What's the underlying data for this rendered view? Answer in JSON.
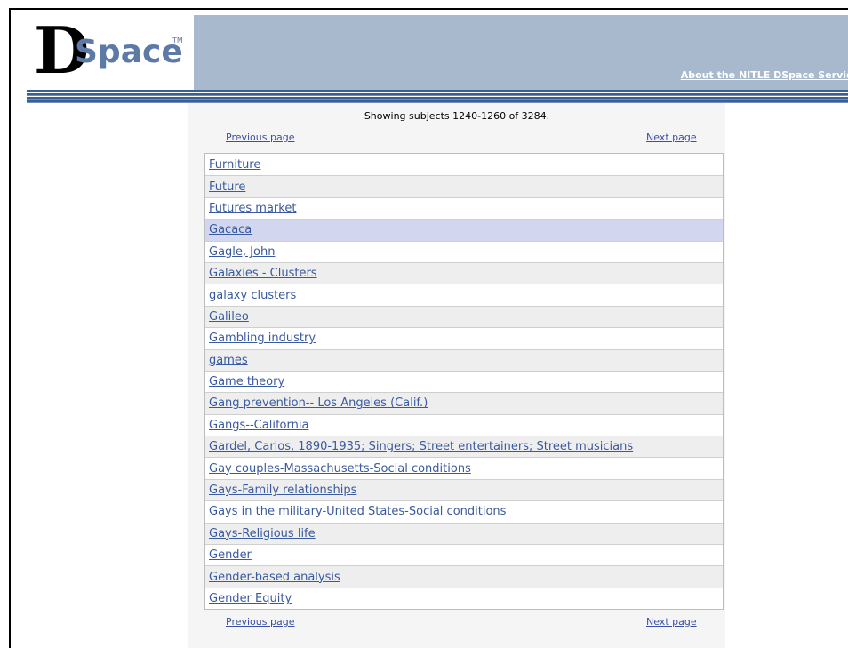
{
  "header": {
    "logo_d": "D",
    "logo_space": "Space",
    "logo_tm": "TM",
    "about_link": "About the NITLE DSpace Service",
    "banner_color": "#a8b9ce",
    "stripe_color": "#3a5f96"
  },
  "browse": {
    "showing_text": "Showing subjects 1240-1260 of 3284.",
    "previous_label": "Previous page",
    "next_label": "Next page",
    "highlight_color": "#d2d7ef",
    "link_color": "#3a5aa0",
    "subjects": [
      "Furniture",
      "Future",
      "Futures market",
      "Gacaca",
      "Gagle, John",
      "Galaxies - Clusters",
      "galaxy clusters",
      "Galileo",
      "Gambling industry",
      "games",
      "Game theory",
      "Gang prevention-- Los Angeles (Calif.)",
      "Gangs--California",
      "Gardel, Carlos, 1890-1935; Singers; Street entertainers; Street musicians",
      "Gay couples-Massachusetts-Social conditions",
      "Gays-Family relationships",
      "Gays in the military-United States-Social conditions",
      "Gays-Religious life",
      "Gender",
      "Gender-based analysis",
      "Gender Equity"
    ],
    "highlighted_subject": "Gacaca"
  }
}
